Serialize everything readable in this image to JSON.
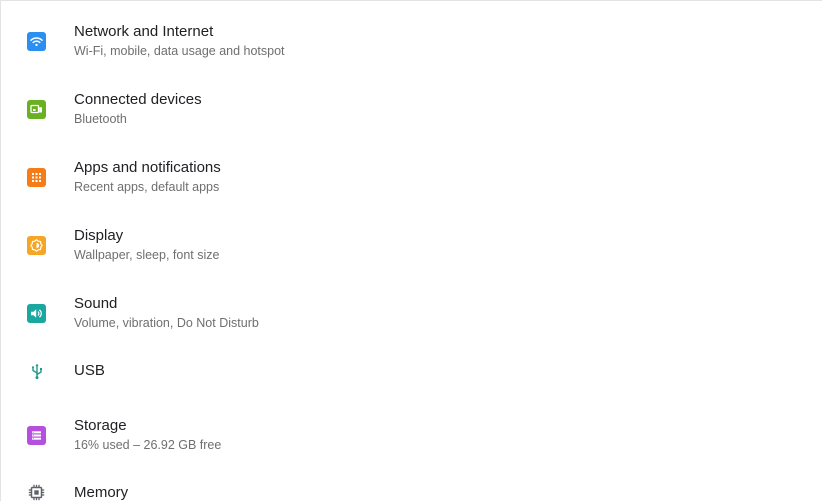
{
  "colors": {
    "network": "#2b8ef1",
    "connected": "#6ab023",
    "apps": "#f57c17",
    "display": "#f6a525",
    "sound": "#1aa7a0",
    "usb": "#1e9a8a",
    "storage": "#b44fe0",
    "memory": "#5f6368"
  },
  "settings": {
    "items": [
      {
        "title": "Network and Internet",
        "subtitle": "Wi-Fi, mobile, data usage and hotspot",
        "icon": "wifi-icon"
      },
      {
        "title": "Connected devices",
        "subtitle": "Bluetooth",
        "icon": "devices-icon"
      },
      {
        "title": "Apps and notifications",
        "subtitle": "Recent apps, default apps",
        "icon": "apps-grid-icon"
      },
      {
        "title": "Display",
        "subtitle": "Wallpaper, sleep, font size",
        "icon": "brightness-icon"
      },
      {
        "title": "Sound",
        "subtitle": "Volume, vibration, Do Not Disturb",
        "icon": "volume-icon"
      },
      {
        "title": "USB",
        "subtitle": "",
        "icon": "usb-icon"
      },
      {
        "title": "Storage",
        "subtitle": "16% used – 26.92 GB free",
        "icon": "storage-icon"
      },
      {
        "title": "Memory",
        "subtitle": "",
        "icon": "memory-chip-icon"
      }
    ]
  }
}
